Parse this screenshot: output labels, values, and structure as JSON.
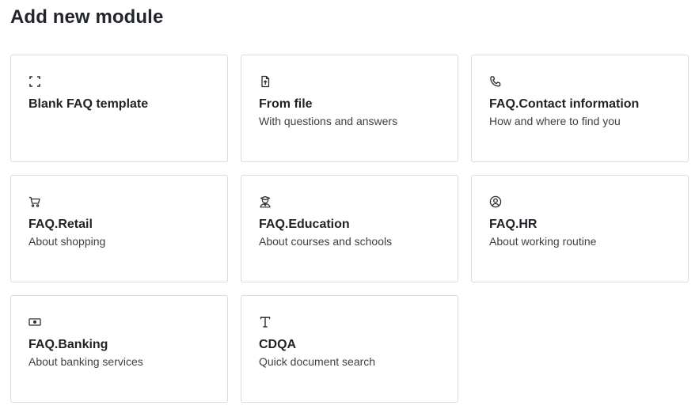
{
  "page": {
    "title": "Add new module"
  },
  "modules": [
    {
      "icon": "fullscreen-icon",
      "title": "Blank FAQ template",
      "description": ""
    },
    {
      "icon": "file-upload-icon",
      "title": "From file",
      "description": "With questions and answers"
    },
    {
      "icon": "phone-icon",
      "title": "FAQ.Contact information",
      "description": "How and where to find you"
    },
    {
      "icon": "shopping-cart-icon",
      "title": "FAQ.Retail",
      "description": "About shopping"
    },
    {
      "icon": "graduate-icon",
      "title": "FAQ.Education",
      "description": "About courses and schools"
    },
    {
      "icon": "user-circle-icon",
      "title": "FAQ.HR",
      "description": "About working routine"
    },
    {
      "icon": "banknote-icon",
      "title": "FAQ.Banking",
      "description": "About banking services"
    },
    {
      "icon": "text-t-icon",
      "title": "CDQA",
      "description": "Quick document search"
    }
  ]
}
